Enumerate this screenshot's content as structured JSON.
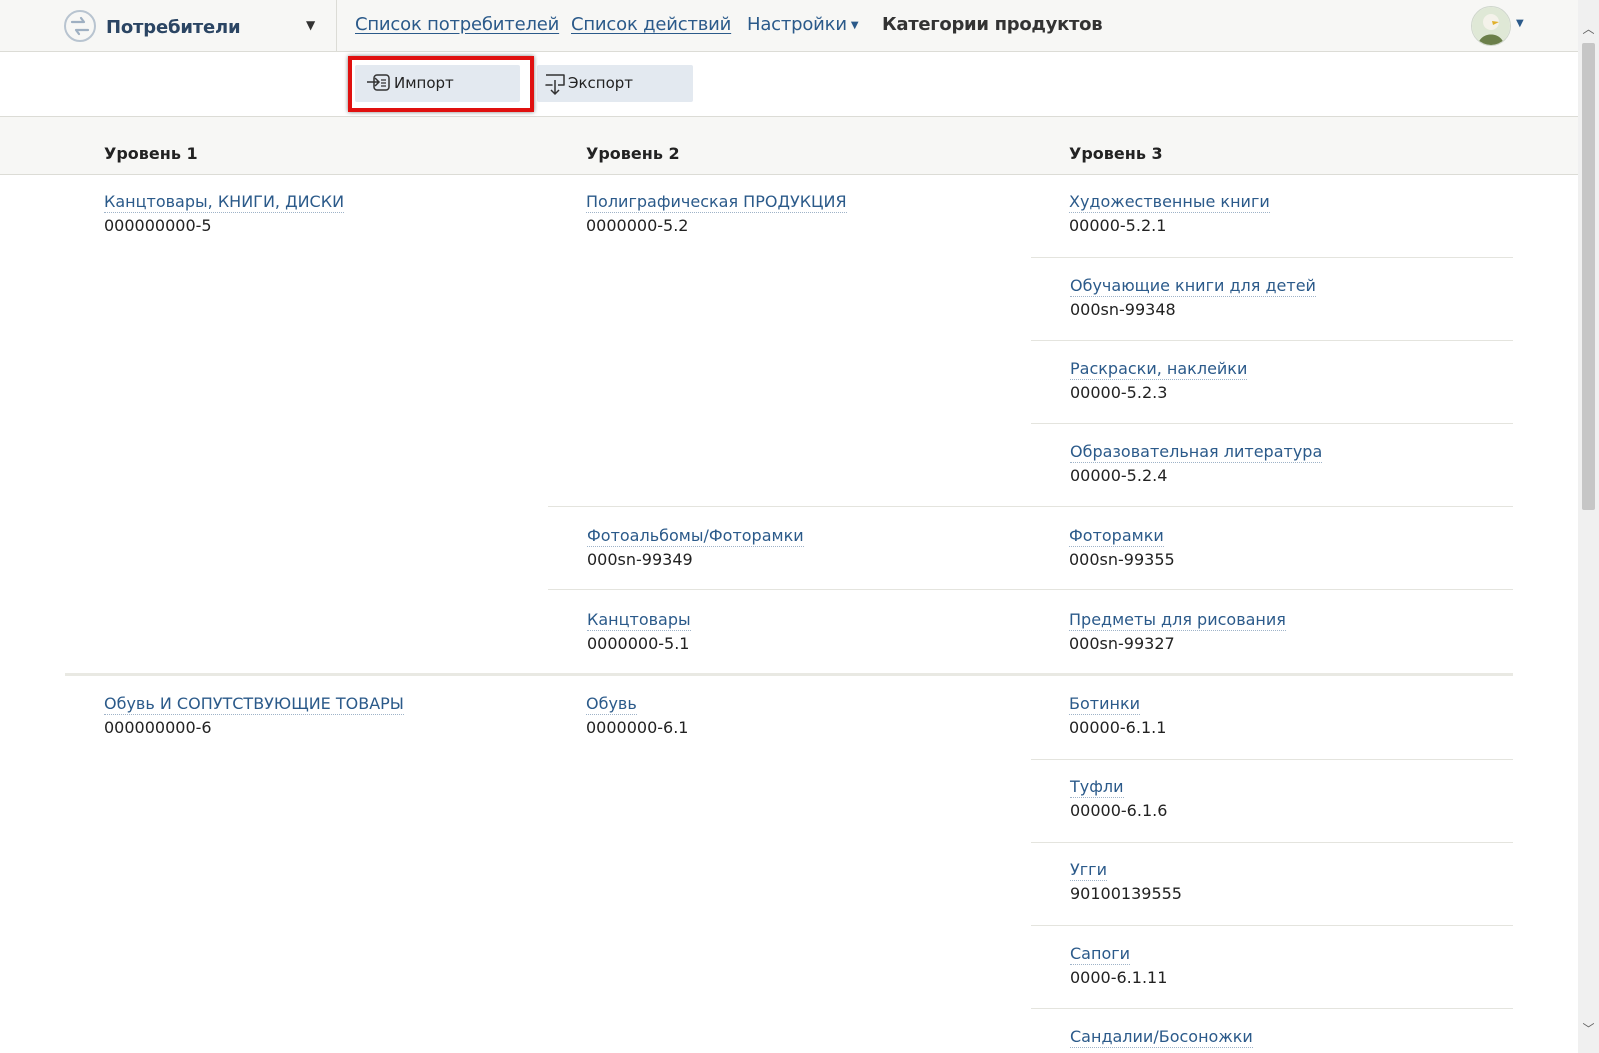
{
  "header": {
    "app_title": "Потребители",
    "nav": {
      "consumers_list": "Список потребителей",
      "actions_list": "Список действий",
      "settings": "Настройки",
      "product_categories": "Категории продуктов"
    }
  },
  "toolbar": {
    "import_label": "Импорт",
    "export_label": "Экспорт"
  },
  "table": {
    "headers": {
      "level1": "Уровень 1",
      "level2": "Уровень 2",
      "level3": "Уровень 3"
    },
    "rows": [
      {
        "l1": {
          "name": "Канцтовары, КНИГИ, ДИСКИ",
          "code": "000000000-5"
        },
        "l2": [
          {
            "name": "Полиграфическая ПРОДУКЦИЯ",
            "code": "0000000-5.2",
            "l3": [
              {
                "name": "Художественные книги",
                "code": "00000-5.2.1"
              },
              {
                "name": "Обучающие книги для детей",
                "code": "000sn-99348"
              },
              {
                "name": "Раскраски, наклейки",
                "code": "00000-5.2.3"
              },
              {
                "name": "Образовательная литература",
                "code": "00000-5.2.4"
              }
            ]
          },
          {
            "name": "Фотоальбомы/Фоторамки",
            "code": "000sn-99349",
            "l3": [
              {
                "name": "Фоторамки",
                "code": "000sn-99355"
              }
            ]
          },
          {
            "name": "Канцтовары",
            "code": "0000000-5.1",
            "l3": [
              {
                "name": "Предметы для рисования",
                "code": "000sn-99327"
              }
            ]
          }
        ]
      },
      {
        "l1": {
          "name": "Обувь И СОПУТСТВУЮЩИЕ ТОВАРЫ",
          "code": "000000000-6"
        },
        "l2": [
          {
            "name": "Обувь",
            "code": "0000000-6.1",
            "l3": [
              {
                "name": "Ботинки",
                "code": "00000-6.1.1"
              },
              {
                "name": "Туфли",
                "code": "00000-6.1.6"
              },
              {
                "name": "Угги",
                "code": "90100139555"
              },
              {
                "name": "Сапоги",
                "code": "0000-6.1.11"
              },
              {
                "name": "Сандалии/Босоножки",
                "code": ""
              }
            ]
          }
        ]
      }
    ]
  },
  "colors": {
    "link": "#2b5a8a",
    "highlight": "#e0100f",
    "button_bg": "#e3e9f0"
  }
}
